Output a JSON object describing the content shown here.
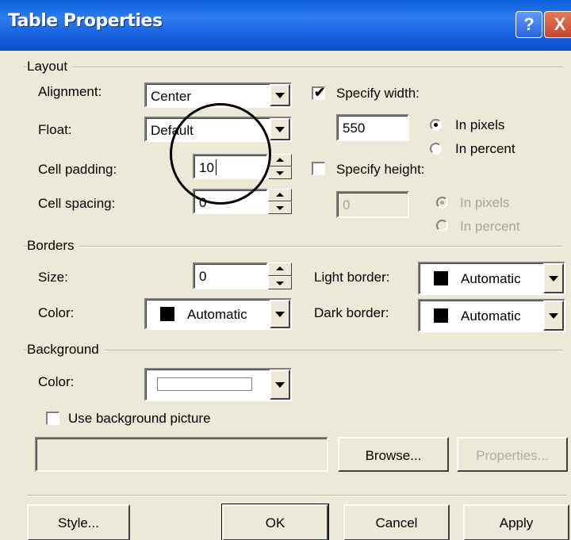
{
  "window": {
    "title": "Table Properties",
    "help_label": "?",
    "close_label": "X"
  },
  "layout": {
    "group_title": "Layout",
    "alignment": {
      "label": "Alignment:",
      "value": "Center"
    },
    "float": {
      "label": "Float:",
      "value": "Default"
    },
    "cell_padding": {
      "label": "Cell padding:",
      "value": "10"
    },
    "cell_spacing": {
      "label": "Cell spacing:",
      "value": "0"
    },
    "specify_width": {
      "label": "Specify width:",
      "checked": true,
      "value": "550",
      "in_pixels": "In pixels",
      "in_percent": "In percent"
    },
    "specify_height": {
      "label": "Specify height:",
      "checked": false,
      "value": "0",
      "in_pixels": "In pixels",
      "in_percent": "In percent"
    }
  },
  "borders": {
    "group_title": "Borders",
    "size": {
      "label": "Size:",
      "value": "0"
    },
    "color": {
      "label": "Color:",
      "value": "Automatic"
    },
    "light_border": {
      "label": "Light border:",
      "value": "Automatic"
    },
    "dark_border": {
      "label": "Dark border:",
      "value": "Automatic"
    }
  },
  "background": {
    "group_title": "Background",
    "color": {
      "label": "Color:"
    },
    "use_picture": {
      "label": "Use background picture",
      "checked": false
    },
    "picture_path": "",
    "browse_label": "Browse...",
    "properties_label": "Properties..."
  },
  "footer": {
    "style_label": "Style...",
    "ok_label": "OK",
    "cancel_label": "Cancel",
    "apply_label": "Apply"
  },
  "colors": {
    "titlebar": "#0a5fd8",
    "face": "#ece9d8"
  }
}
